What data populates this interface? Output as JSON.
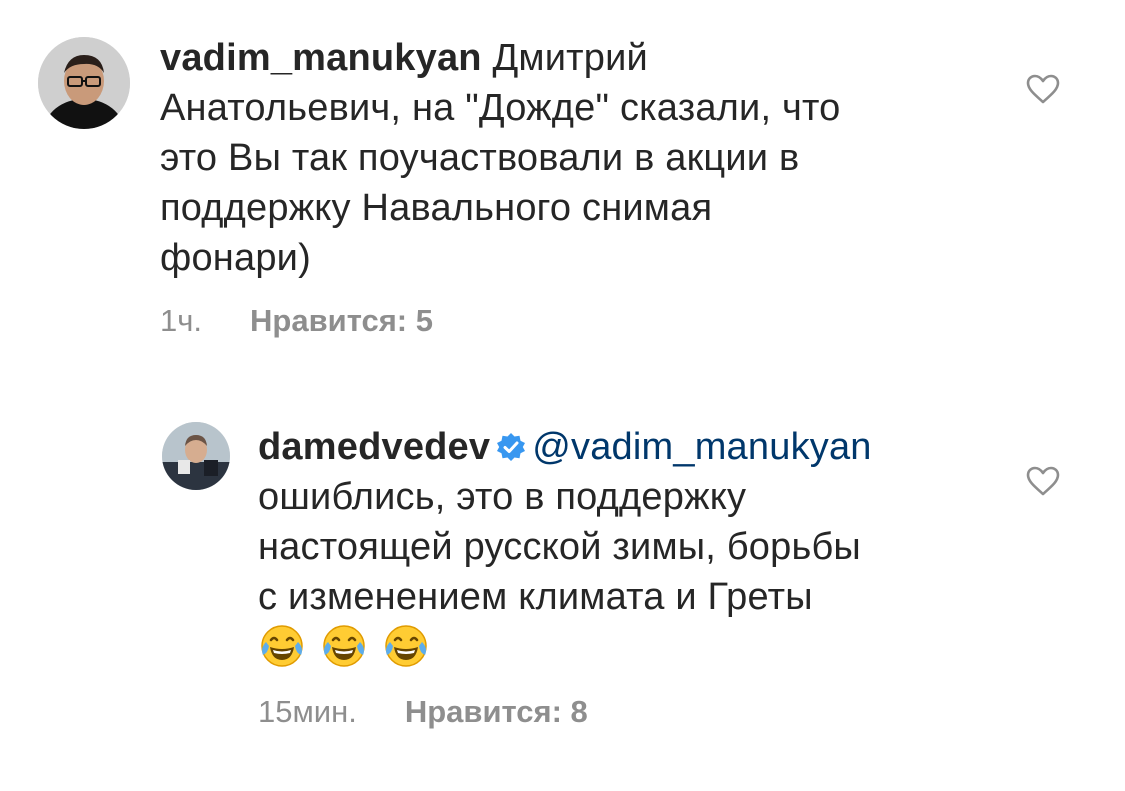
{
  "comments": [
    {
      "username": "vadim_manukyan",
      "text": "Дмитрий Анатольевич, на \"Дожде\" сказали, что это Вы так поучаствовали в акции в поддержку Навального снимая фонари)",
      "line1": "Дмитрий",
      "line2": "Анатольевич, на \"Дожде\" сказали, что",
      "line3": "это Вы так поучаствовали в акции в",
      "line4": "поддержку Навального снимая",
      "line5": "фонари)",
      "time": "1ч.",
      "likes": "Нравится: 5"
    },
    {
      "username": "damedvedev",
      "verified": true,
      "mention": "@vadim_manukyan",
      "text": "ошиблись, это в поддержку настоящей русской зимы, борьбы с изменением климата и Греты 😂😂😂",
      "line2": "ошиблись, это в поддержку",
      "line3": "настоящей русской зимы, борьбы",
      "line4": "с изменением климата и Греты",
      "emoji": [
        "face-with-tears-of-joy-icon",
        "face-with-tears-of-joy-icon",
        "face-with-tears-of-joy-icon"
      ],
      "time": "15мин.",
      "likes": "Нравится: 8"
    }
  ],
  "colors": {
    "text": "#262626",
    "meta": "#8e8e8e",
    "mention": "#00376b",
    "verified": "#3897f0"
  }
}
